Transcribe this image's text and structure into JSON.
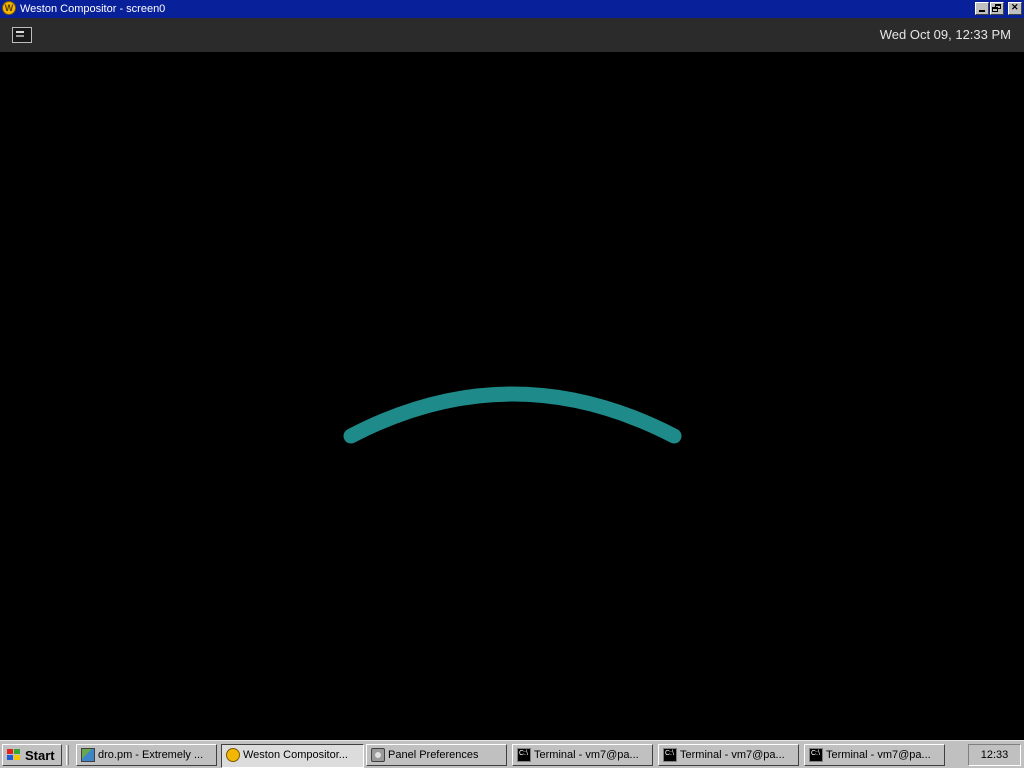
{
  "window": {
    "title": "Weston Compositor - screen0",
    "icon": "weston-icon"
  },
  "panel": {
    "launcher_icon": "terminal-icon",
    "clock": "Wed Oct 09, 12:33 PM"
  },
  "desktop": {
    "arc_color": "#1e8a8a"
  },
  "taskbar": {
    "start_label": "Start",
    "tasks": [
      {
        "label": "dro.pm - Extremely ...",
        "icon": "image-icon"
      },
      {
        "label": "Weston Compositor...",
        "icon": "weston-icon"
      },
      {
        "label": "Panel Preferences",
        "icon": "preferences-icon"
      },
      {
        "label": "Terminal - vm7@pa...",
        "icon": "terminal-icon"
      },
      {
        "label": "Terminal - vm7@pa...",
        "icon": "terminal-icon"
      },
      {
        "label": "Terminal - vm7@pa...",
        "icon": "terminal-icon"
      }
    ],
    "tray_time": "12:33"
  }
}
